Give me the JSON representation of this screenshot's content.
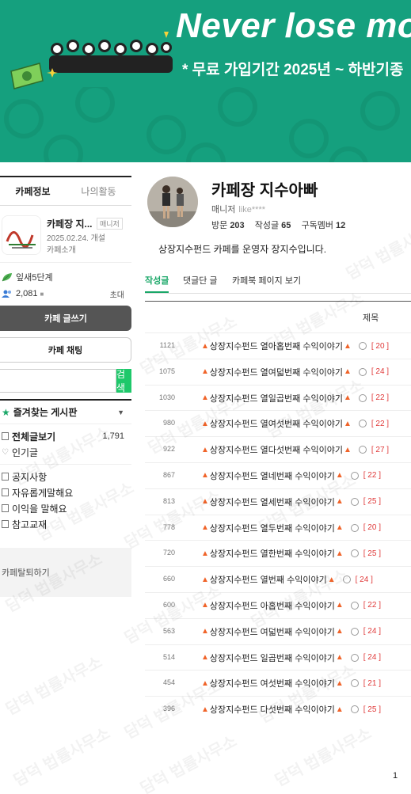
{
  "banner": {
    "title": "Never lose mo",
    "subtitle": "* 무료 가입기간  2025년 ~ 하반기종"
  },
  "sidebar": {
    "tabs": [
      "카페정보",
      "나의활동"
    ],
    "cafe": {
      "name": "카페장 지...",
      "role": "매니저",
      "date": "2025.02.24. 개설",
      "intro": "카페소개"
    },
    "level": "잎새5단계",
    "members": "2,081",
    "invite": "초대",
    "write_button": "카페 글쓰기",
    "chat_button": "카페 채팅",
    "search_button": "검색",
    "favorites_title": "즐겨찾는 게시판",
    "menu_main": [
      {
        "label": "전체글보기",
        "count": "1,791"
      },
      {
        "label": "인기글",
        "count": ""
      }
    ],
    "menu_boards": [
      "공지사항",
      "자유롭게말해요",
      "이익을 말해요",
      "참고교재"
    ],
    "leave": "카페탈퇴하기"
  },
  "profile": {
    "name": "카페장 지수아빠",
    "role": "매니저",
    "id": "like****",
    "visits_label": "방문",
    "visits": "203",
    "posts_label": "작성글",
    "posts": "65",
    "subs_label": "구독멤버",
    "subs": "12",
    "description": "상장지수펀드 카페를 운영자 장지수입니다."
  },
  "tabs": [
    "작성글",
    "댓글단 글",
    "카페북 페이지 보기"
  ],
  "column_header": "제목",
  "posts": [
    {
      "num": "1121",
      "title": "상장지수펀드 열아홉번째 수익이야기",
      "comments": "[ 20 ]"
    },
    {
      "num": "1075",
      "title": "상장지수펀드 열여덟번째 수익이야기",
      "comments": "[ 24 ]"
    },
    {
      "num": "1030",
      "title": "상장지수펀드 열일곱번째 수익이야기",
      "comments": "[ 22 ]"
    },
    {
      "num": "980",
      "title": "상장지수펀드 열여섯번째 수익이야기",
      "comments": "[ 22 ]"
    },
    {
      "num": "922",
      "title": "상장지수펀드 열다섯번째 수익이야기",
      "comments": "[ 27 ]"
    },
    {
      "num": "867",
      "title": "상장지수펀드 열네번째 수익이야기",
      "comments": "[ 22 ]"
    },
    {
      "num": "813",
      "title": "상장지수펀드 열세번째 수익이야기",
      "comments": "[ 25 ]"
    },
    {
      "num": "778",
      "title": "상장지수펀드 열두번째 수익이야기",
      "comments": "[ 20 ]"
    },
    {
      "num": "720",
      "title": "상장지수펀드 열한번째 수익이야기",
      "comments": "[ 25 ]"
    },
    {
      "num": "660",
      "title": "상장지수펀드 열번째 수익이야기",
      "comments": "[ 24 ]"
    },
    {
      "num": "600",
      "title": "상장지수펀드 아홉번째 수익이야기",
      "comments": "[ 22 ]"
    },
    {
      "num": "563",
      "title": "상장지수펀드 여덟번째 수익이야기",
      "comments": "[ 24 ]"
    },
    {
      "num": "514",
      "title": "상장지수펀드 일곱번째 수익이야기",
      "comments": "[ 24 ]"
    },
    {
      "num": "454",
      "title": "상장지수펀드 여섯번째 수익이야기",
      "comments": "[ 21 ]"
    },
    {
      "num": "396",
      "title": "상장지수펀드 다섯번째 수익이야기",
      "comments": "[ 25 ]"
    }
  ],
  "page_number": "1",
  "watermark": "담덕 법률사무소",
  "colors": {
    "banner": "#15a07e",
    "accent": "#1aa768",
    "search": "#1ec86a",
    "comment": "#e03a3a"
  }
}
